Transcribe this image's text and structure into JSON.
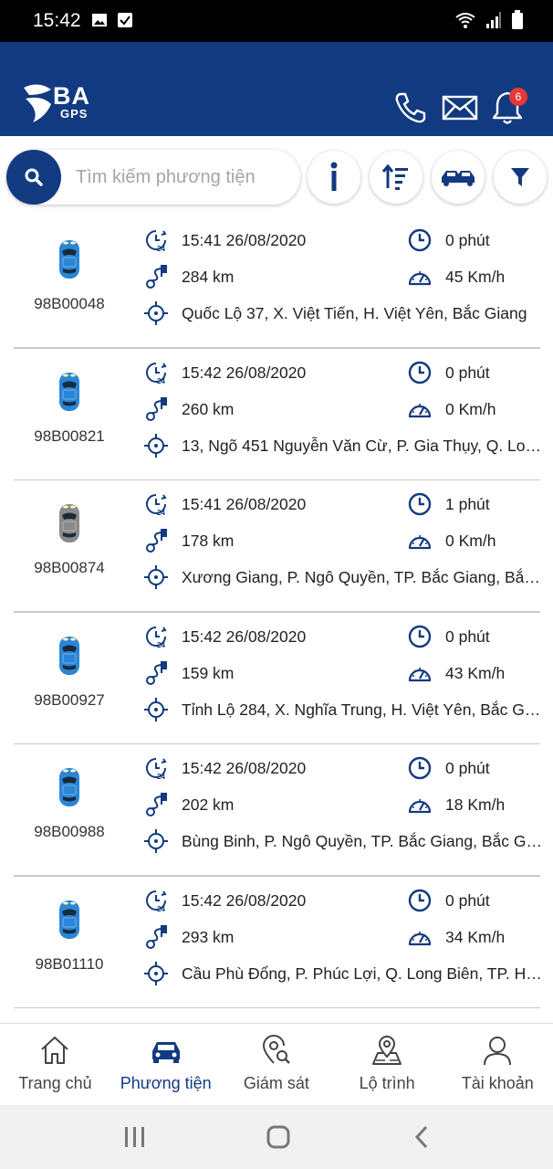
{
  "status_bar": {
    "time": "15:42"
  },
  "header": {
    "logo_text": "BA",
    "logo_sub": "GPS",
    "notification_count": "6"
  },
  "search": {
    "placeholder": "Tìm kiếm phương tiện"
  },
  "vehicles": [
    {
      "plate": "98B00048",
      "color": "#2a86d8",
      "time": "15:41 26/08/2020",
      "duration": "0 phút",
      "distance": "284 km",
      "speed": "45 Km/h",
      "address": "Quốc Lộ 37, X. Việt Tiến, H. Việt Yên, Bắc Giang"
    },
    {
      "plate": "98B00821",
      "color": "#2a86d8",
      "time": "15:42 26/08/2020",
      "duration": "0 phút",
      "distance": "260 km",
      "speed": "0 Km/h",
      "address": "13, Ngõ 451 Nguyễn Văn Cừ, P. Gia Thụy, Q. Lon..."
    },
    {
      "plate": "98B00874",
      "color": "#8a8a8a",
      "time": "15:41 26/08/2020",
      "duration": "1 phút",
      "distance": "178 km",
      "speed": "0 Km/h",
      "address": "Xương Giang, P. Ngô Quyền, TP. Bắc Giang, Bắc ..."
    },
    {
      "plate": "98B00927",
      "color": "#2a86d8",
      "time": "15:42 26/08/2020",
      "duration": "0 phút",
      "distance": "159 km",
      "speed": "43 Km/h",
      "address": "Tỉnh Lộ 284, X. Nghĩa Trung, H. Việt Yên, Bắc Gia..."
    },
    {
      "plate": "98B00988",
      "color": "#2a86d8",
      "time": "15:42 26/08/2020",
      "duration": "0 phút",
      "distance": "202 km",
      "speed": "18 Km/h",
      "address": "Bùng Binh, P. Ngô Quyền, TP. Bắc Giang, Bắc Gia..."
    },
    {
      "plate": "98B01110",
      "color": "#2a86d8",
      "time": "15:42 26/08/2020",
      "duration": "0 phút",
      "distance": "293 km",
      "speed": "34 Km/h",
      "address": "Cầu Phù Đổng, P. Phúc Lợi, Q. Long Biên, TP. Hà ..."
    }
  ],
  "nav": [
    {
      "label": "Trang chủ",
      "icon": "home-icon"
    },
    {
      "label": "Phương tiện",
      "icon": "car-icon"
    },
    {
      "label": "Giám sát",
      "icon": "monitor-pin-icon"
    },
    {
      "label": "Lộ trình",
      "icon": "route-map-icon"
    },
    {
      "label": "Tài khoản",
      "icon": "account-icon"
    }
  ],
  "colors": {
    "primary": "#123a80",
    "moving_car": "#2a86d8",
    "stopped_car": "#8a8a8a",
    "badge": "#e53935"
  }
}
